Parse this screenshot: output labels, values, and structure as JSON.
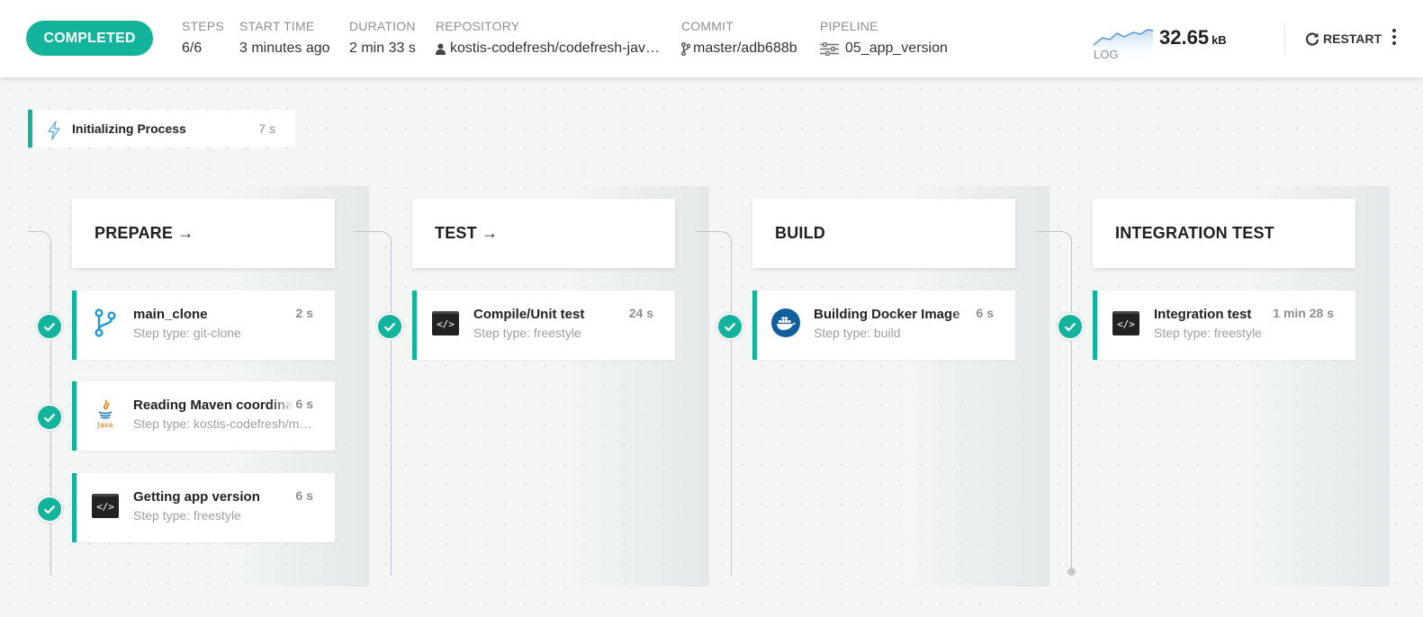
{
  "header": {
    "status": "COMPLETED",
    "meta": [
      {
        "label": "STEPS",
        "value": "6/6"
      },
      {
        "label": "START TIME",
        "value": "3 minutes ago"
      },
      {
        "label": "DURATION",
        "value": "2 min 33 s"
      },
      {
        "label": "REPOSITORY",
        "value": "kostis-codefresh/codefresh-jav…"
      },
      {
        "label": "COMMIT",
        "value": "master/adb688b"
      },
      {
        "label": "PIPELINE",
        "value": "05_app_version"
      }
    ],
    "log_label": "LOG",
    "log_size": "32.65",
    "log_unit": "kB",
    "restart_label": "RESTART"
  },
  "init": {
    "name": "Initializing Process",
    "duration": "7 s"
  },
  "stages": [
    {
      "title": "PREPARE →",
      "steps": [
        {
          "name": "main_clone",
          "type": "Step type: git-clone",
          "duration": "2 s",
          "icon": "git-branch-icon"
        },
        {
          "name": "Reading Maven coordinates",
          "type": "Step type: kostis-codefresh/m…",
          "duration": "6 s",
          "icon": "java-icon"
        },
        {
          "name": "Getting app version",
          "type": "Step type: freestyle",
          "duration": "6 s",
          "icon": "terminal-code-icon"
        }
      ]
    },
    {
      "title": "TEST →",
      "steps": [
        {
          "name": "Compile/Unit test",
          "type": "Step type: freestyle",
          "duration": "24 s",
          "icon": "terminal-code-icon"
        }
      ]
    },
    {
      "title": "BUILD",
      "steps": [
        {
          "name": "Building Docker Image",
          "type": "Step type: build",
          "duration": "6 s",
          "icon": "docker-icon"
        }
      ]
    },
    {
      "title": "INTEGRATION TEST",
      "steps": [
        {
          "name": "Integration test",
          "type": "Step type: freestyle",
          "duration": "1 min 28 s",
          "icon": "terminal-code-icon"
        }
      ]
    }
  ],
  "colors": {
    "accent": "#14b39b",
    "icon_blue": "#1f9ad6",
    "docker_blue": "#0f5f9c",
    "java_orange": "#e76f00"
  }
}
